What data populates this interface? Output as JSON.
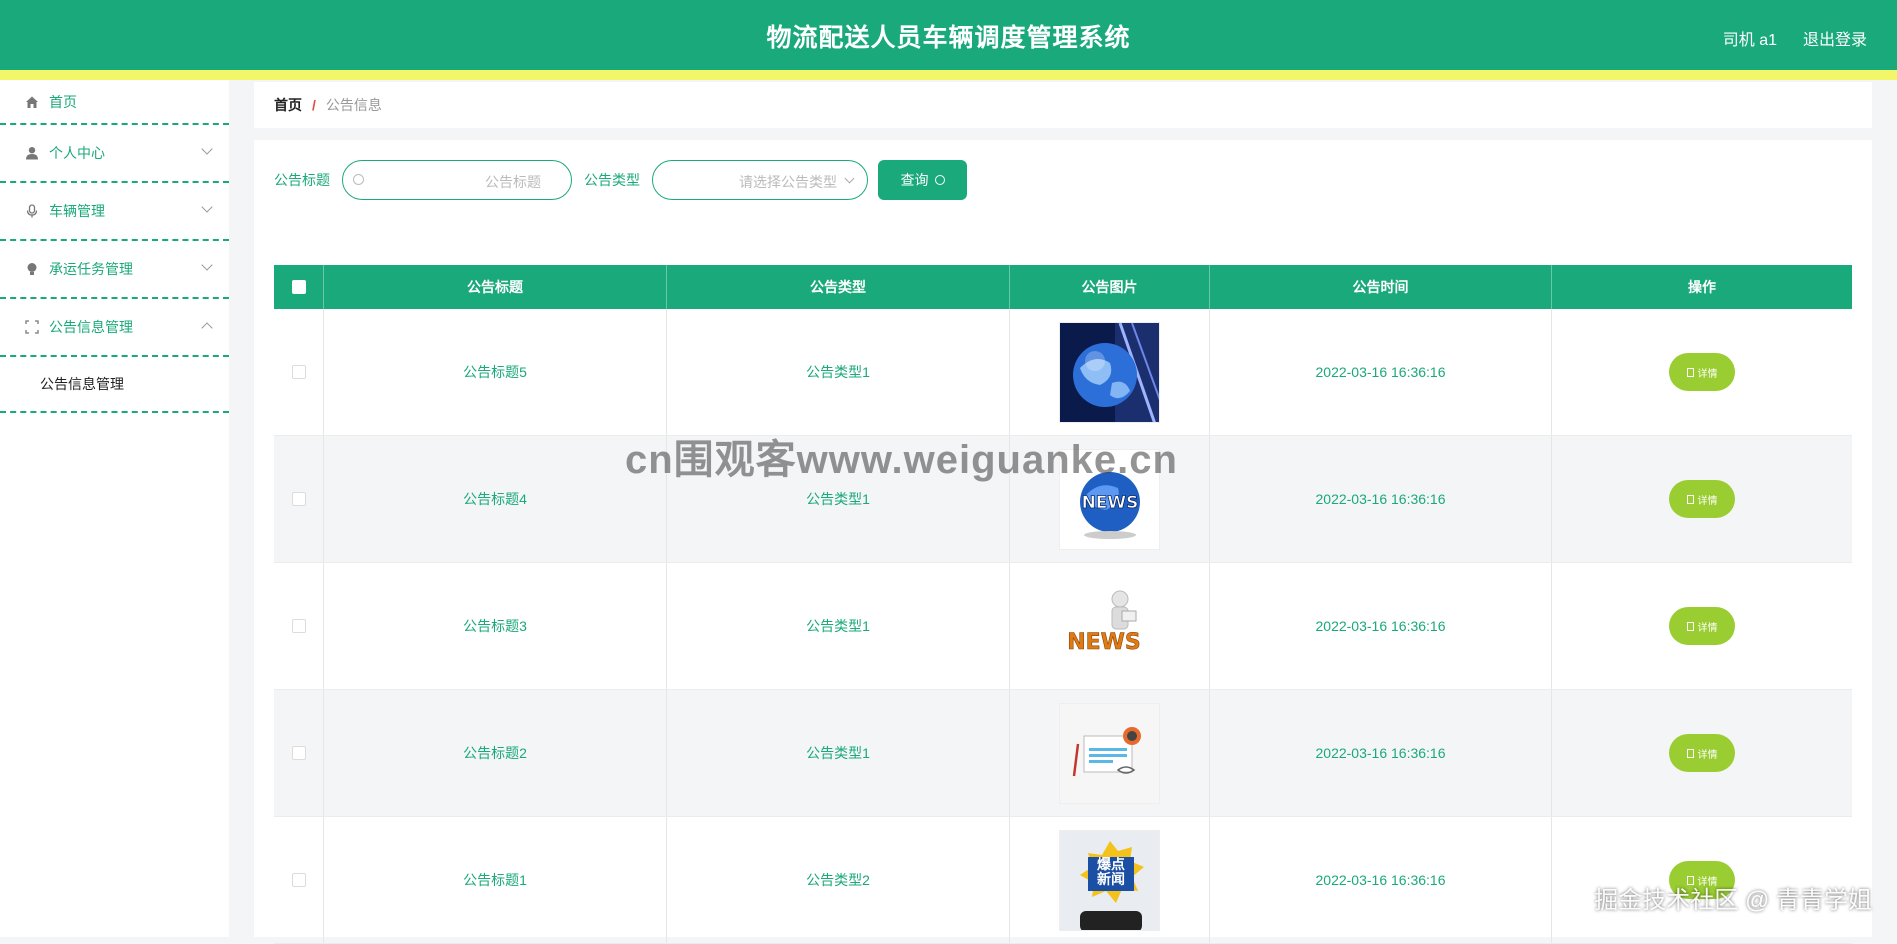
{
  "header": {
    "title": "物流配送人员车辆调度管理系统",
    "user": "司机 a1",
    "logout": "退出登录"
  },
  "sidebar": {
    "items": [
      {
        "label": "首页"
      },
      {
        "label": "个人中心"
      },
      {
        "label": "车辆管理"
      },
      {
        "label": "承运任务管理"
      },
      {
        "label": "公告信息管理"
      }
    ],
    "sub_item": "公告信息管理"
  },
  "breadcrumb": {
    "home": "首页",
    "sep": "/",
    "current": "公告信息"
  },
  "search": {
    "title_label": "公告标题",
    "title_placeholder": "公告标题",
    "type_label": "公告类型",
    "type_placeholder": "请选择公告类型",
    "button": "查询"
  },
  "table": {
    "headers": [
      "公告标题",
      "公告类型",
      "公告图片",
      "公告时间",
      "操作"
    ],
    "rows": [
      {
        "title": "公告标题5",
        "type": "公告类型1",
        "time": "2022-03-16 16:36:16",
        "action": "详情"
      },
      {
        "title": "公告标题4",
        "type": "公告类型1",
        "time": "2022-03-16 16:36:16",
        "action": "详情"
      },
      {
        "title": "公告标题3",
        "type": "公告类型1",
        "time": "2022-03-16 16:36:16",
        "action": "详情"
      },
      {
        "title": "公告标题2",
        "type": "公告类型1",
        "time": "2022-03-16 16:36:16",
        "action": "详情"
      },
      {
        "title": "公告标题1",
        "type": "公告类型2",
        "time": "2022-03-16 16:36:16",
        "action": "详情"
      }
    ]
  },
  "thumb_texts": {
    "news": "NEWS",
    "news3": "NEWS",
    "burst": "爆点新闻"
  },
  "watermark": "cn围观客www.weiguanke.cn",
  "watermark2": "掘金技术社区 @ 青青学姐",
  "colors": {
    "primary": "#1aa97a",
    "stripe": "#f2f76a",
    "detail": "#9acd32",
    "crumb_sep": "#e64b3c"
  }
}
